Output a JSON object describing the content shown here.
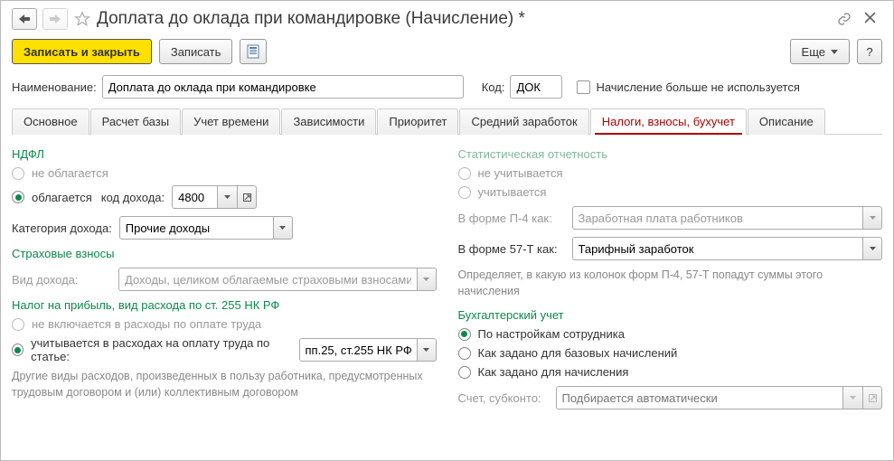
{
  "header": {
    "title": "Доплата до оклада при командировке (Начисление) *"
  },
  "toolbar": {
    "save_close": "Записать и закрыть",
    "save": "Записать",
    "more": "Еще",
    "help": "?"
  },
  "fields": {
    "name_label": "Наименование:",
    "name_value": "Доплата до оклада при командировке",
    "code_label": "Код:",
    "code_value": "ДОК",
    "unused_label": "Начисление больше не используется"
  },
  "tabs": [
    "Основное",
    "Расчет базы",
    "Учет времени",
    "Зависимости",
    "Приоритет",
    "Средний заработок",
    "Налоги, взносы, бухучет",
    "Описание"
  ],
  "left": {
    "ndfl_title": "НДФЛ",
    "ndfl_opt1": "не облагается",
    "ndfl_opt2": "облагается",
    "income_code_label": "код дохода:",
    "income_code_value": "4800",
    "income_cat_label": "Категория дохода:",
    "income_cat_value": "Прочие доходы",
    "sv_title": "Страховые взносы",
    "sv_kind_label": "Вид дохода:",
    "sv_kind_value": "Доходы, целиком облагаемые страховыми взносами",
    "np_title": "Налог на прибыль, вид расхода по ст. 255 НК РФ",
    "np_opt1": "не включается в расходы по оплате труда",
    "np_opt2": "учитывается в расходах на оплату труда по статье:",
    "np_article_value": "пп.25, ст.255 НК РФ",
    "np_hint": "Другие виды расходов, произведенных в пользу работника, предусмотренных трудовым договором и (или) коллективным договором"
  },
  "right": {
    "stat_title": "Статистическая отчетность",
    "stat_opt1": "не учитывается",
    "stat_opt2": "учитывается",
    "p4_label": "В форме П-4 как:",
    "p4_value": "Заработная плата работников",
    "t57_label": "В форме 57-Т как:",
    "t57_value": "Тарифный заработок",
    "stat_hint": "Определяет, в какую из колонок форм П-4, 57-Т попадут суммы этого начисления",
    "bu_title": "Бухгалтерский учет",
    "bu_opt1": "По настройкам сотрудника",
    "bu_opt2": "Как задано для базовых начислений",
    "bu_opt3": "Как задано для начисления",
    "account_label": "Счет, субконто:",
    "account_placeholder": "Подбирается автоматически"
  }
}
